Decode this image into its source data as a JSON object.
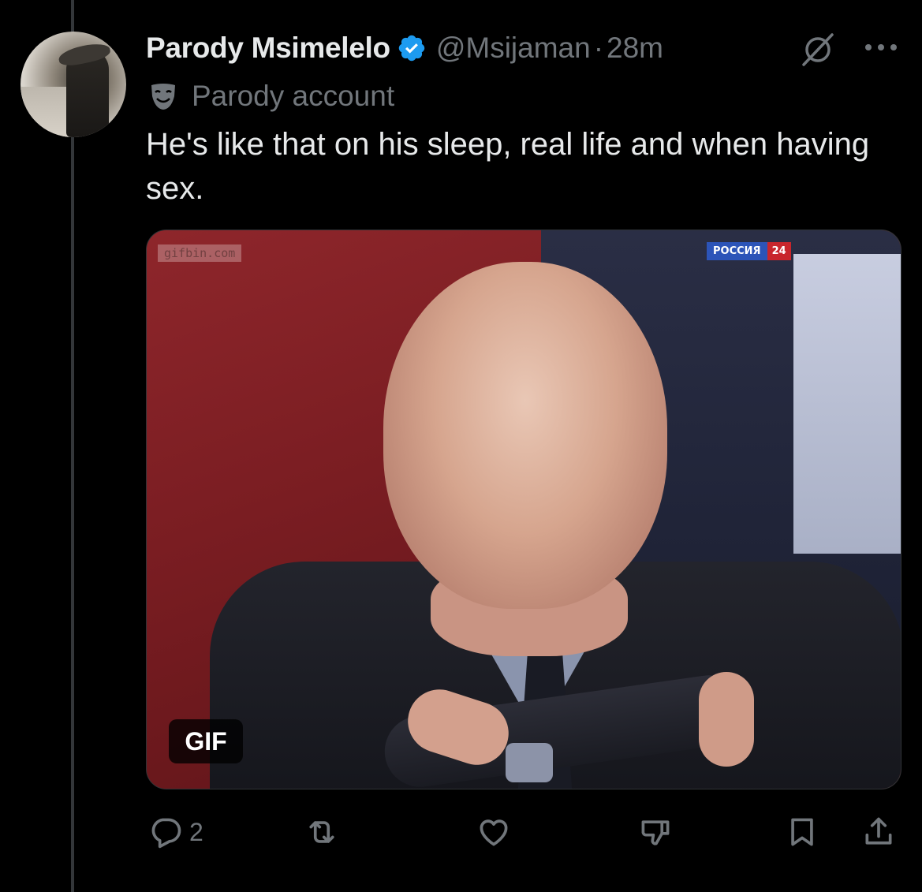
{
  "tweet": {
    "author_name": "Parody Msimelelo",
    "handle": "@Msijaman",
    "separator": "·",
    "time_ago": "28m",
    "parody_label": "Parody account",
    "text": "He's like that on his sleep, real life and when having sex.",
    "media": {
      "watermark": "gifbin.com",
      "channel_name": "РОССИЯ",
      "channel_number": "24",
      "badge": "GIF"
    },
    "actions": {
      "reply_count": "2"
    }
  },
  "colors": {
    "background": "#000000",
    "primary_text": "#e7e9ea",
    "secondary_text": "#71767b",
    "verified_badge": "#1d9bf0",
    "thread_line": "#333639"
  },
  "icons": {
    "verified": "verified-badge-icon",
    "grok": "grok-icon",
    "more": "more-icon",
    "parody": "parody-mask-icon",
    "reply": "reply-icon",
    "repost": "repost-icon",
    "like": "heart-icon",
    "dislike": "downvote-icon",
    "bookmark": "bookmark-icon",
    "share": "share-icon"
  }
}
